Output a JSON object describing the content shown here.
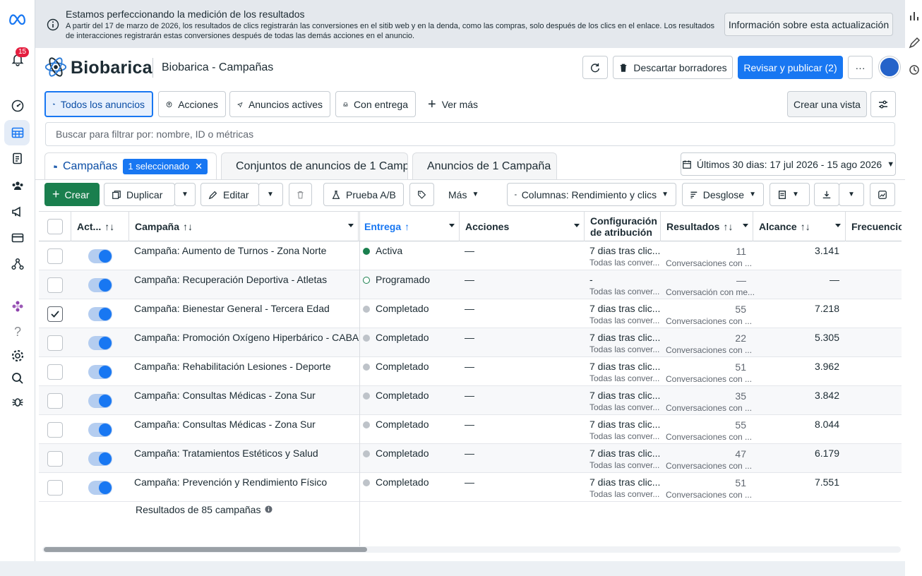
{
  "nav": {
    "notification_count": "15",
    "icons": [
      "meta-logo-icon",
      "bell-icon",
      "dashboard-icon",
      "campaigns-table-icon",
      "document-icon",
      "audiences-icon",
      "megaphone-icon",
      "billing-card-icon",
      "business-network-icon",
      "apps-flower-icon",
      "help-icon",
      "settings-icon",
      "search-icon",
      "bug-icon"
    ]
  },
  "notice": {
    "title": "Estamos perfeccionando la medición de los resultados",
    "body": "A partir del 17 de marzo de 2026, los resultados de clics registrarán las conversiones en el sitib web y en la denda, como las compras, solo después de los clics en el enlace. Los resultados de interacciones registrarán estas conversiones después de todas las demás acciones en el anuncio.",
    "button": "Información sobre esta actualización"
  },
  "header": {
    "brand": "Biobarica",
    "title": "Biobarica - Campañas",
    "discard": "Descartar borradores",
    "publish": "Revisar y publicar (2)",
    "more": "···"
  },
  "filters": {
    "all_ads": "Todos los anuncios",
    "actions": "Acciones",
    "active_ads": "Anuncios actives",
    "with_delivery": "Con entrega",
    "see_more": "Ver más",
    "create_view": "Crear una vista"
  },
  "search": {
    "placeholder": "Buscar para filtrar por: nombre, ID o métricas"
  },
  "tabs": {
    "campaigns": "Campañas",
    "selected": "1 seleccionado",
    "adsets": "Conjuntos de anuncios de 1 Camp",
    "ads": "Anuncios de 1 Campaña",
    "date_range": "Últimos 30 dias: 17 jul 2026 - 15 ago 2026"
  },
  "toolbar": {
    "create": "Crear",
    "duplicate": "Duplicar",
    "edit": "Editar",
    "ab_test": "Prueba A/B",
    "more": "Más",
    "columns": "Columnas: Rendimiento y clics",
    "breakdown": "Desglose"
  },
  "table": {
    "headers": {
      "active": "Act...",
      "campaign": "Campaña",
      "delivery": "Entrega",
      "actions": "Acciones",
      "attribution_1": "Configuración",
      "attribution_2": "de atribución",
      "results": "Resultados",
      "reach": "Alcance",
      "frequency": "Frecuencio"
    },
    "rows": [
      {
        "name": "Campaña: Aumento de Turnos - Zona Norte",
        "status": "Activa",
        "status_color": "#1a7f4e",
        "actions": "—",
        "attr": "7 dias tras clic...",
        "attr_sub": "Todas las conver...",
        "results": "11",
        "results_sub": "Conversaciones con ...",
        "reach": "3.141",
        "checked": false
      },
      {
        "name": "Campaña: Recuperación Deportiva - Atletas",
        "status": "Programado",
        "status_color": "#1a7f4e",
        "actions": "—",
        "attr": "-",
        "attr_sub": "Todas las conver...",
        "results": "—",
        "results_sub": "Conversación con me...",
        "reach": "—",
        "checked": false
      },
      {
        "name": "Campaña: Bienestar General - Tercera Edad",
        "status": "Completado",
        "status_color": "#bec3c9",
        "actions": "—",
        "attr": "7 dias tras clic...",
        "attr_sub": "Todas las conver...",
        "results": "55",
        "results_sub": "Conversaciones con ...",
        "reach": "7.218",
        "checked": true
      },
      {
        "name": "Campaña: Promoción Oxígeno Hiperbárico - CABA",
        "status": "Completado",
        "status_color": "#bec3c9",
        "actions": "—",
        "attr": "7 dias tras clic...",
        "attr_sub": "Todas las conver...",
        "results": "22",
        "results_sub": "Conversaciones con ...",
        "reach": "5.305",
        "checked": false
      },
      {
        "name": "Campaña: Rehabilitación Lesiones - Deporte",
        "status": "Completado",
        "status_color": "#bec3c9",
        "actions": "—",
        "attr": "7 dias tras clic...",
        "attr_sub": "Todas las conver...",
        "results": "51",
        "results_sub": "Conversaciones con ...",
        "reach": "3.962",
        "checked": false
      },
      {
        "name": "Campaña: Consultas Médicas - Zona Sur",
        "status": "Completado",
        "status_color": "#bec3c9",
        "actions": "—",
        "attr": "7 dias tras clic...",
        "attr_sub": "Todas las conver...",
        "results": "35",
        "results_sub": "Conversaciones con ...",
        "reach": "3.842",
        "checked": false
      },
      {
        "name": "Campaña: Consultas Médicas - Zona Sur",
        "status": "Completado",
        "status_color": "#bec3c9",
        "actions": "—",
        "attr": "7 dias tras clic...",
        "attr_sub": "Todas las conver...",
        "results": "55",
        "results_sub": "Conversaciones con ...",
        "reach": "8.044",
        "checked": false
      },
      {
        "name": "Campaña: Tratamientos Estéticos y Salud",
        "status": "Completado",
        "status_color": "#bec3c9",
        "actions": "—",
        "attr": "7 dias tras clic...",
        "attr_sub": "Todas las conver...",
        "results": "47",
        "results_sub": "Conversaciones con ...",
        "reach": "6.179",
        "checked": false
      },
      {
        "name": "Campaña: Prevención y Rendimiento Físico",
        "status": "Completado",
        "status_color": "#bec3c9",
        "actions": "—",
        "attr": "7 dias tras clic...",
        "attr_sub": "Todas las conver...",
        "results": "51",
        "results_sub": "Conversaciones con ...",
        "reach": "7.551",
        "checked": false
      }
    ],
    "footer": "Resultados de 85 campañas"
  },
  "colors": {
    "accent": "#1877f2",
    "create": "#1a7f4e",
    "active_dot": "#1a7f4e",
    "completed_dot": "#bec3c9"
  }
}
